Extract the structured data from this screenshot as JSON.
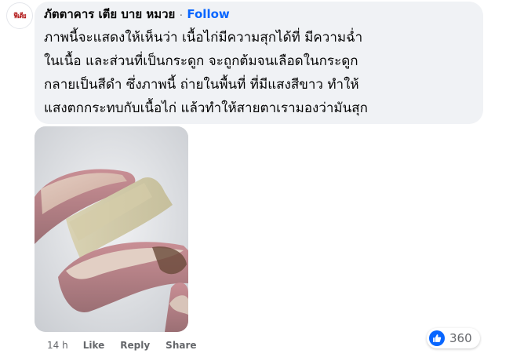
{
  "comment": {
    "author": "ภัตตาคาร เตีย บาย หมวย",
    "separator": "·",
    "follow_label": "Follow",
    "avatar_text": "ฟีเตีย",
    "text_lines": [
      "ภาพนี้จะแสดงให้เห็นว่า เนื้อไก่มีความสุกได้ที่ มีความฉ่ำ",
      "ในเนื้อ และส่วนที่เป็นกระดูก จะถูกต้มจนเลือดในกระดูก",
      "กลายเป็นสีดำ ซึ่งภาพนี้ ถ่ายในพื้นที่ ที่มีแสงสีขาว ทำให้",
      "แสงตกกระทบกับเนื้อไก่ แล้วทำให้สายตาเรามองว่ามันสุก"
    ],
    "time": "14 h",
    "like_label": "Like",
    "reply_label": "Reply",
    "share_label": "Share",
    "reaction_icon": "like-thumb-icon",
    "reaction_count": "360"
  },
  "colors": {
    "bubble_bg": "#f0f2f5",
    "follow_blue": "#0866ff",
    "meta_gray": "#65676b",
    "like_blue": "#0866ff"
  }
}
